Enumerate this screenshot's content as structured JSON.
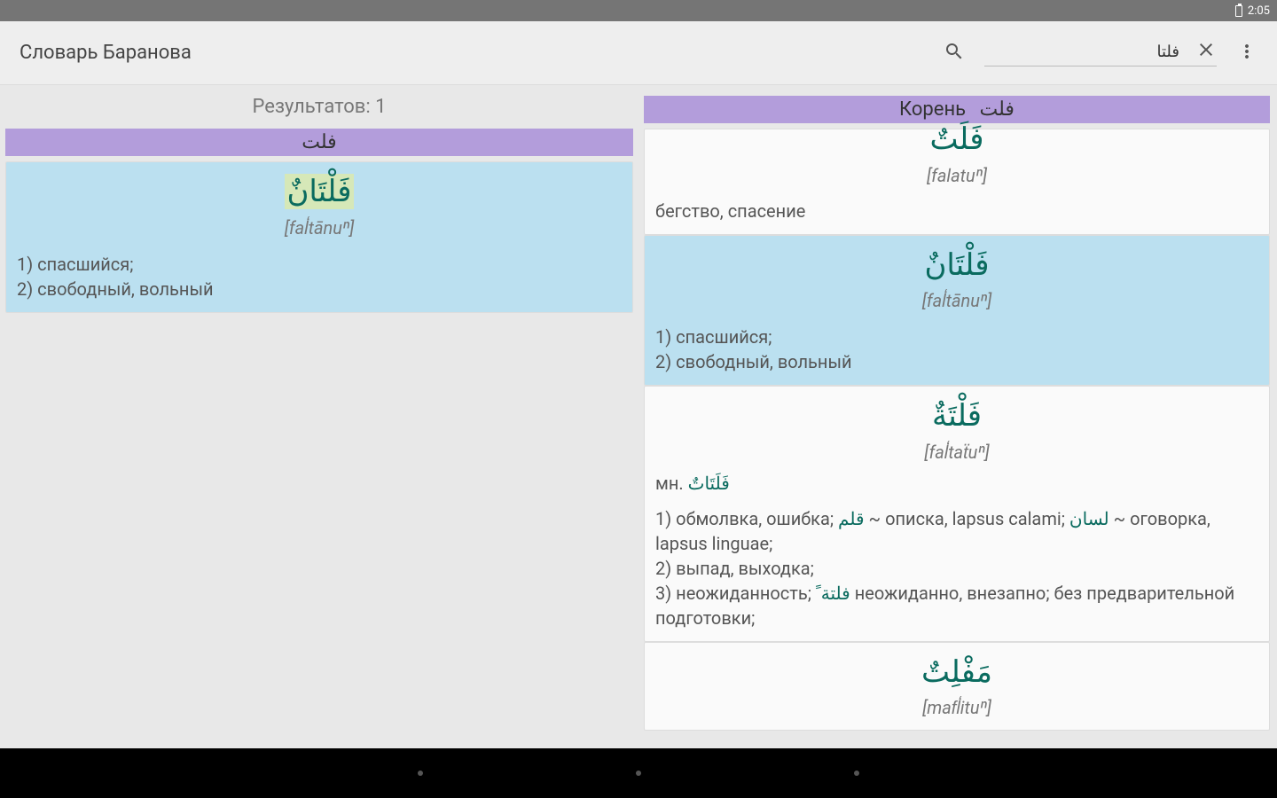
{
  "status": {
    "time": "2:05"
  },
  "toolbar": {
    "title": "Словарь Баранова",
    "search_value": "فلتا"
  },
  "left": {
    "results_label": "Результатов: 1",
    "root_ar": "فلت",
    "entry": {
      "arabic": "فَلْتَانٌ",
      "translit": "[fal͏̒tānuⁿ]",
      "body": "1) спасшийся;\n2) свободный, вольный"
    }
  },
  "right": {
    "root_label": "Корень",
    "root_ar": "فلت",
    "entries": [
      {
        "arabic": "فَلَتٌ",
        "translit": "[falatuⁿ]",
        "body": "бегство, спасение",
        "highlight": false,
        "cut_top": true
      },
      {
        "arabic": "فَلْتَانٌ",
        "translit": "[fal͏̒tānuⁿ]",
        "body": "1) спасшийся;\n2) свободный, вольный",
        "highlight": true
      },
      {
        "arabic": "فَلْتَةٌ",
        "translit": "[fal͏̒taẗuⁿ]",
        "plural_prefix": "мн.",
        "plural_ar": "فَلَتَاتٌ",
        "body_html": "1) обмолвка, ошибка; <span class=\"ar-inline\">قلم</span> ~ описка, lapsus calami; <span class=\"ar-inline\">لسان</span> ~ оговорка, lapsus linguae;\n2) выпад, выходка;\n3) неожиданность; <span class=\"ar-inline\">فلتة ً</span> неожиданно, внезапно; без предварительной подготовки;",
        "highlight": false
      },
      {
        "arabic": "مَفْلِتٌ",
        "translit": "[mafl͏̒ituⁿ]",
        "highlight": false
      }
    ]
  }
}
